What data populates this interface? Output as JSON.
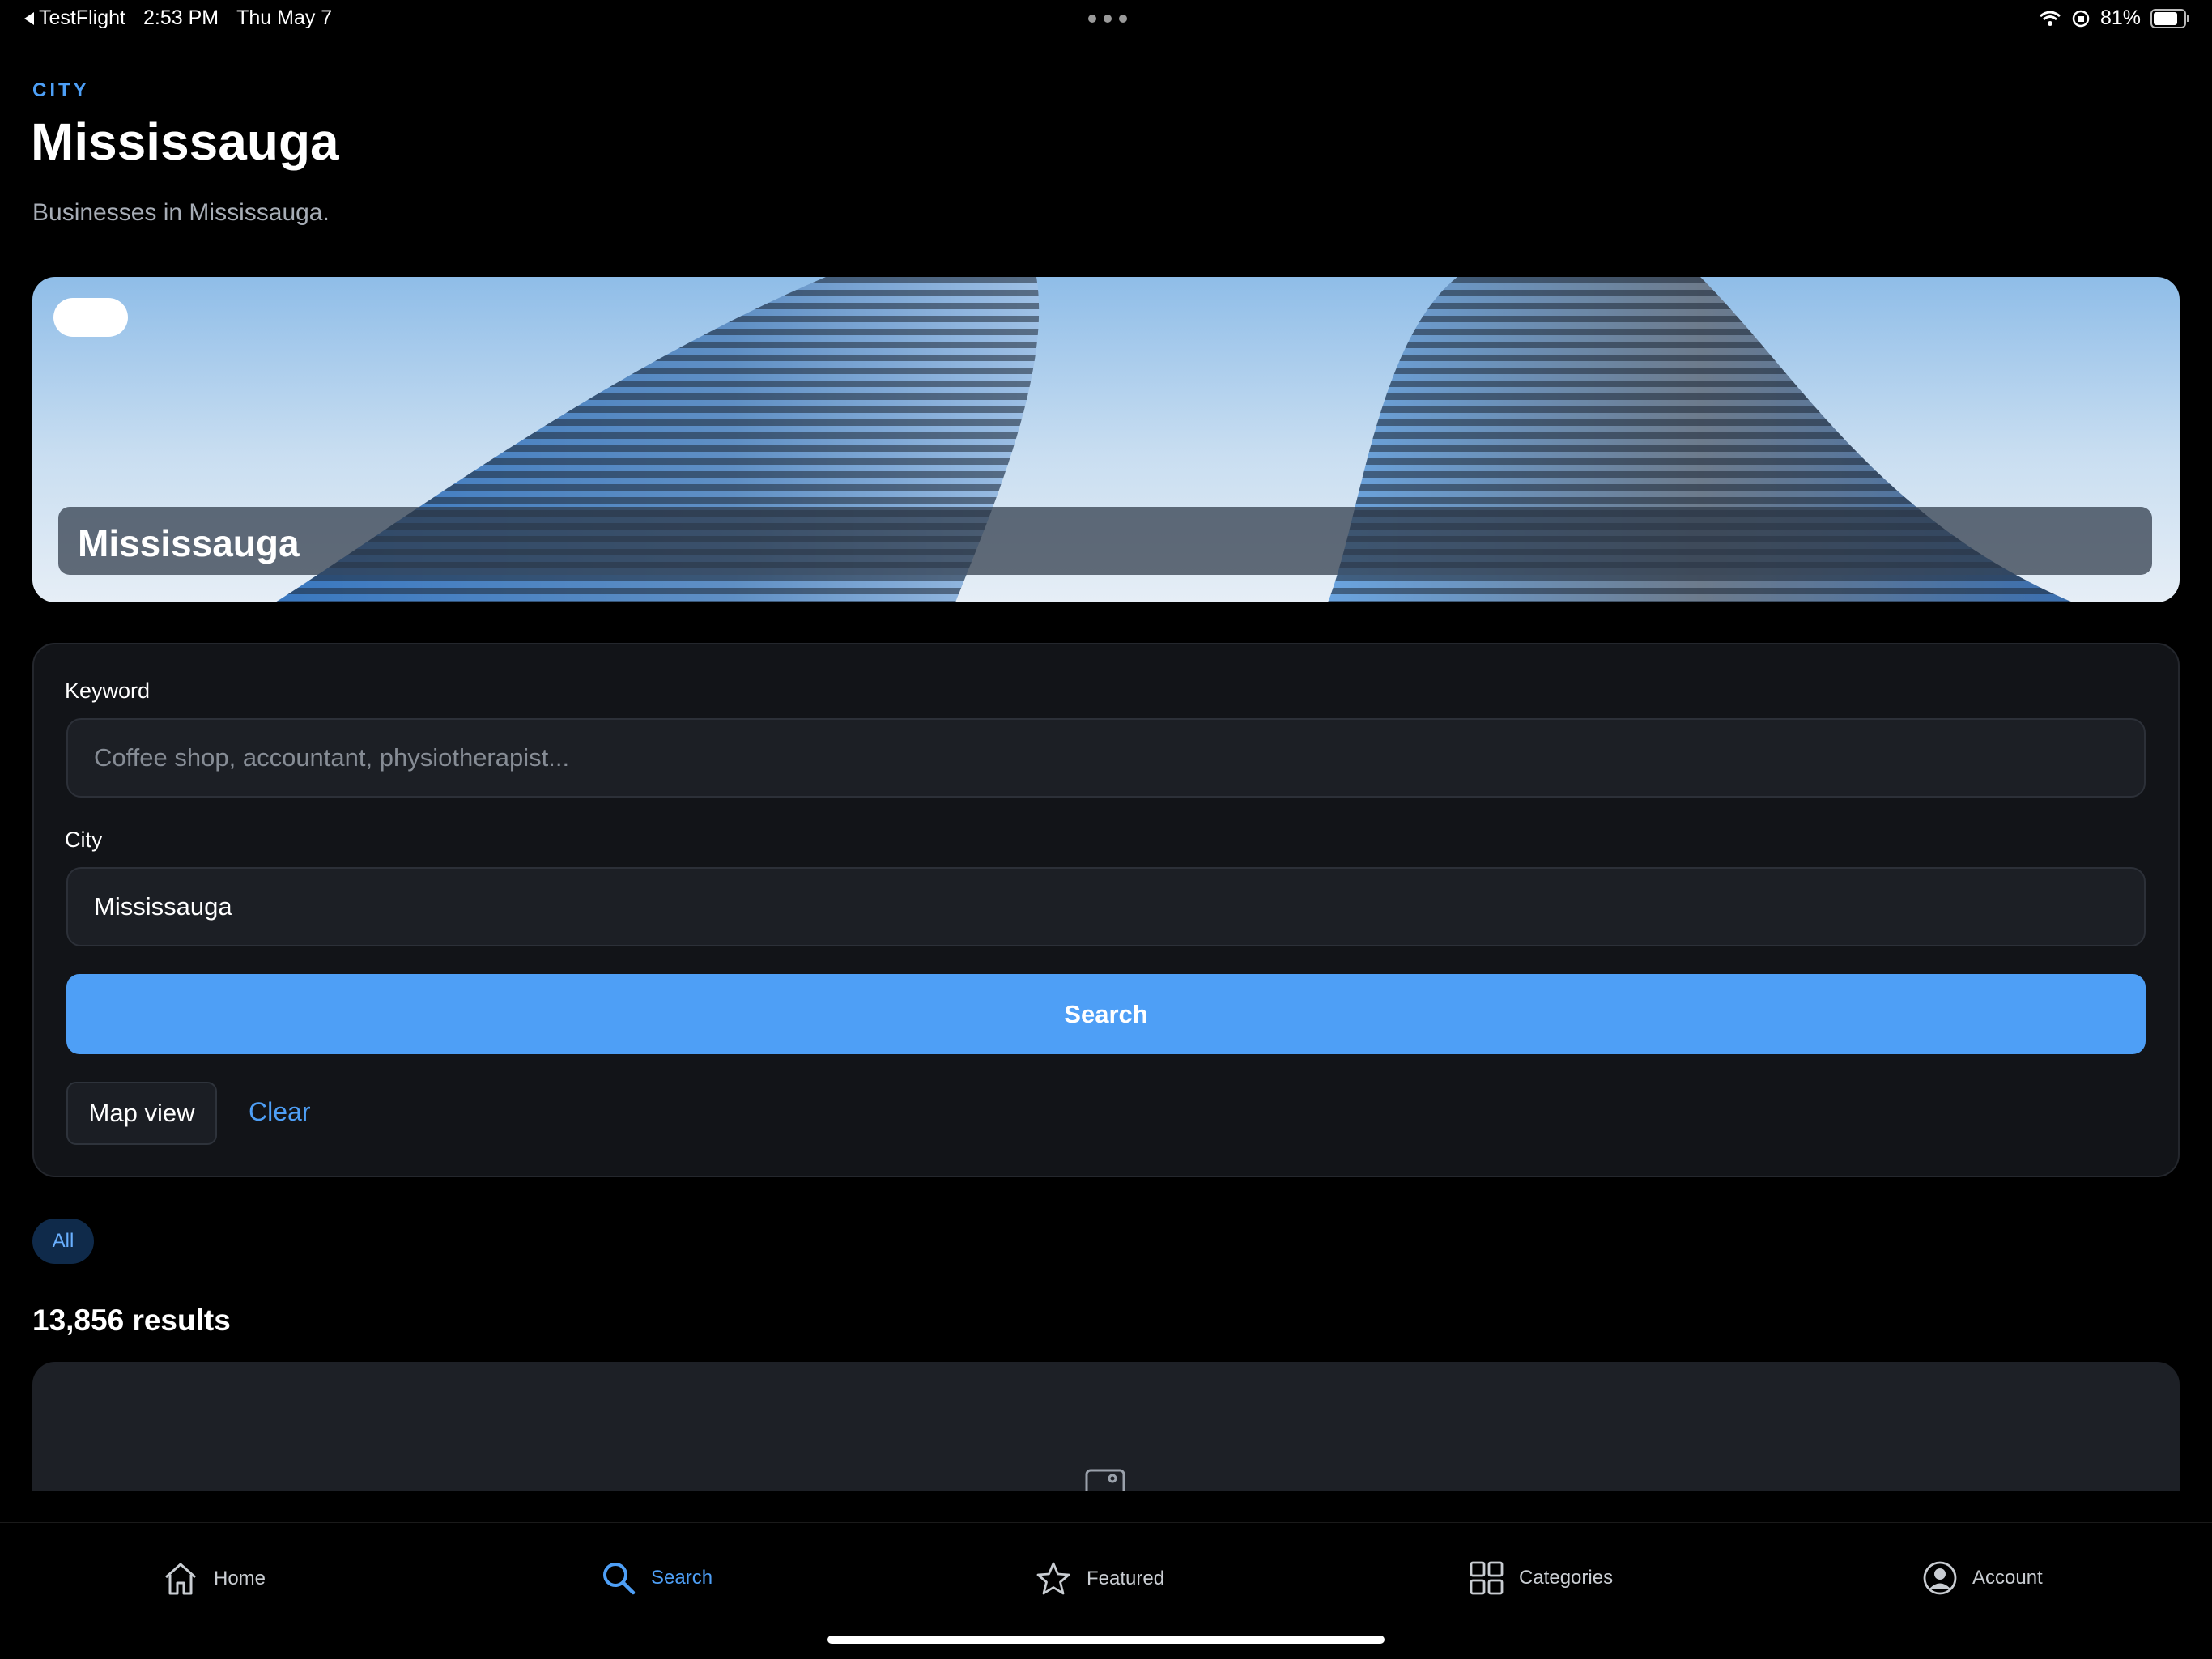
{
  "status_bar": {
    "back_app": "TestFlight",
    "time": "2:53 PM",
    "date": "Thu May 7",
    "battery": "81%"
  },
  "header": {
    "eyebrow": "CITY",
    "title": "Mississauga",
    "subtitle": "Businesses in Mississauga."
  },
  "hero": {
    "caption": "Mississauga"
  },
  "search_form": {
    "keyword_label": "Keyword",
    "keyword_placeholder": "Coffee shop, accountant, physiotherapist...",
    "city_label": "City",
    "city_value": "Mississauga",
    "search_button": "Search",
    "map_view_button": "Map view",
    "clear_link": "Clear"
  },
  "filters": {
    "chips": [
      "All"
    ]
  },
  "results": {
    "count_text": "13,856 results"
  },
  "tab_bar": {
    "tabs": [
      {
        "label": "Home",
        "icon": "home-icon"
      },
      {
        "label": "Search",
        "icon": "search-icon",
        "active": true
      },
      {
        "label": "Featured",
        "icon": "star-icon"
      },
      {
        "label": "Categories",
        "icon": "grid-icon"
      },
      {
        "label": "Account",
        "icon": "account-icon"
      }
    ]
  },
  "colors": {
    "accent": "#4e9ff6",
    "background": "#000000",
    "card": "#121418"
  }
}
